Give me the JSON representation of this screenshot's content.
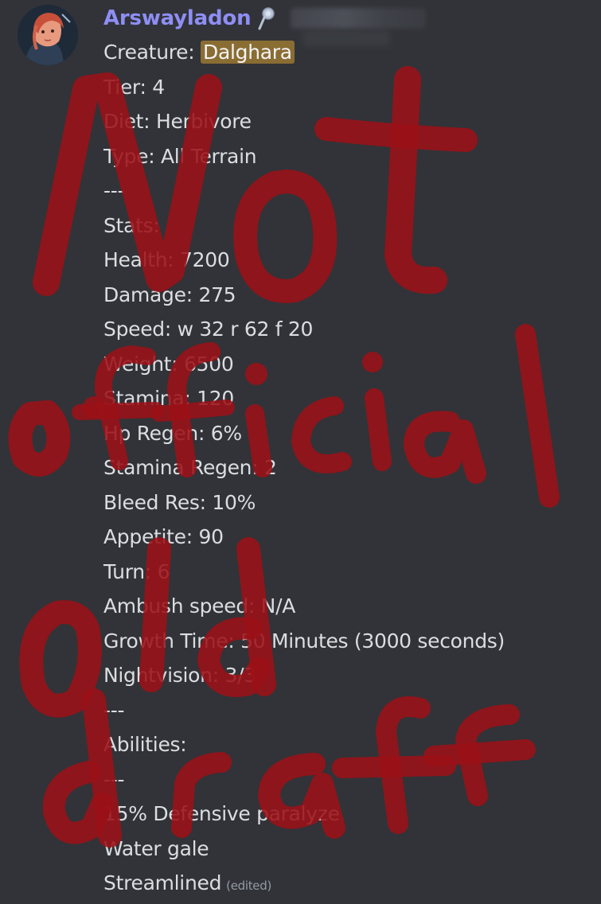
{
  "message": {
    "username": "Arswayladon",
    "edited_label": "(edited)",
    "lines": [
      {
        "label": "Creature: ",
        "value": "Dalghara"
      },
      {
        "text": "Tier: 4"
      },
      {
        "text": "Diet: Herbivore"
      },
      {
        "text": "Type: All Terrain"
      },
      {
        "text": "---"
      },
      {
        "text": "Stats:"
      },
      {
        "text": "Health: 7200"
      },
      {
        "text": "Damage: 275"
      },
      {
        "text": "Speed: w 32 r 62 f 20"
      },
      {
        "text": "Weight: 6500"
      },
      {
        "text": "Stamina: 120"
      },
      {
        "text": "Hp Regen: 6%"
      },
      {
        "text": "Stamina Regen: 2"
      },
      {
        "text": "Bleed Res: 10%"
      },
      {
        "text": "Appetite: 90"
      },
      {
        "text": "Turn: 6"
      },
      {
        "text": "Ambush speed: N/A"
      },
      {
        "text": "Growth Time: 50 Minutes (3000 seconds)"
      },
      {
        "text": "Nightvision: 3/3"
      },
      {
        "text": "---"
      },
      {
        "text": "Abilities:"
      },
      {
        "text": "---"
      },
      {
        "text": "15% Defensive paralyze"
      },
      {
        "text": "Water gale"
      },
      {
        "text": "Streamlined"
      }
    ]
  },
  "overlay": {
    "text": "Not official old draft",
    "color": "#9b1117"
  },
  "colors": {
    "background": "#313338",
    "username": "#8e8ef5",
    "text": "#dbdee1",
    "highlight": "#8a6d33"
  }
}
